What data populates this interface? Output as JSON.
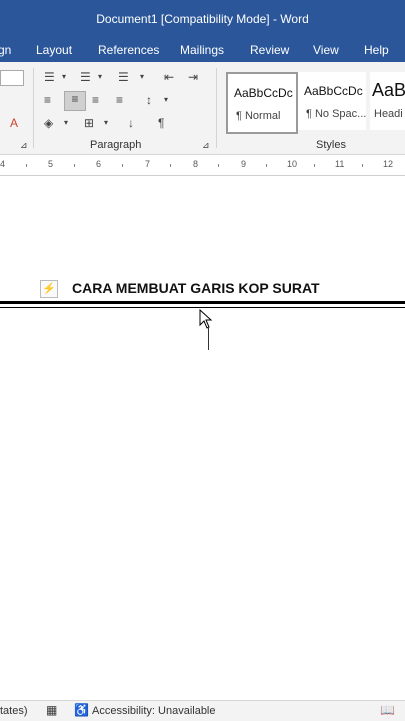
{
  "window": {
    "title": "Document1 [Compatibility Mode]  -  Word"
  },
  "menu": {
    "items": [
      "gn",
      "Layout",
      "References",
      "Mailings",
      "Review",
      "View",
      "Help"
    ]
  },
  "ribbon": {
    "paragraph_label": "Paragraph",
    "styles_label": "Styles",
    "styles": [
      {
        "sample": "AaBbCcDc",
        "name": "¶ Normal"
      },
      {
        "sample": "AaBbCcDc",
        "name": "¶ No Spac..."
      },
      {
        "sample": "AaB",
        "name": "Headi"
      }
    ]
  },
  "ruler": {
    "ticks": [
      "4",
      "5",
      "6",
      "7",
      "8",
      "9",
      "10",
      "11",
      "12"
    ]
  },
  "document": {
    "heading": "CARA MEMBUAT GARIS KOP SURAT"
  },
  "status": {
    "language": "tates)",
    "accessibility": "Accessibility: Unavailable"
  },
  "colors": {
    "brand": "#2b579a",
    "ribbon_bg": "#f3f3f3"
  }
}
